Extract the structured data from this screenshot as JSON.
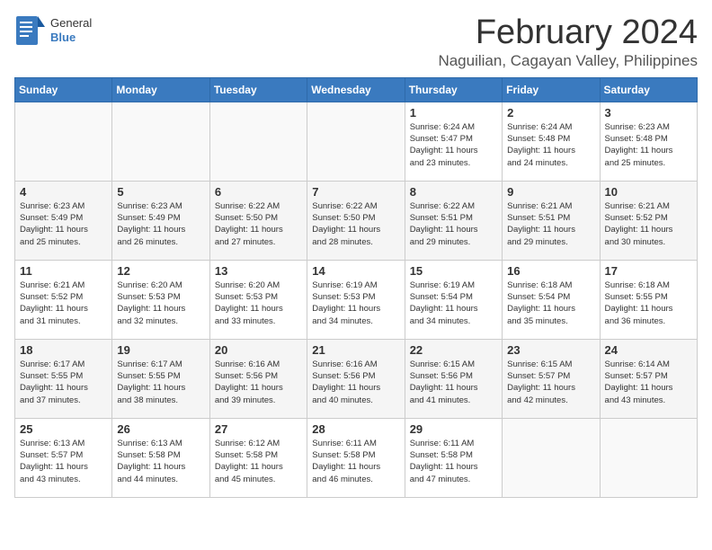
{
  "logo": {
    "text1": "General",
    "text2": "Blue"
  },
  "title": "February 2024",
  "location": "Naguilian, Cagayan Valley, Philippines",
  "days_of_week": [
    "Sunday",
    "Monday",
    "Tuesday",
    "Wednesday",
    "Thursday",
    "Friday",
    "Saturday"
  ],
  "weeks": [
    [
      {
        "day": "",
        "info": ""
      },
      {
        "day": "",
        "info": ""
      },
      {
        "day": "",
        "info": ""
      },
      {
        "day": "",
        "info": ""
      },
      {
        "day": "1",
        "info": "Sunrise: 6:24 AM\nSunset: 5:47 PM\nDaylight: 11 hours\nand 23 minutes."
      },
      {
        "day": "2",
        "info": "Sunrise: 6:24 AM\nSunset: 5:48 PM\nDaylight: 11 hours\nand 24 minutes."
      },
      {
        "day": "3",
        "info": "Sunrise: 6:23 AM\nSunset: 5:48 PM\nDaylight: 11 hours\nand 25 minutes."
      }
    ],
    [
      {
        "day": "4",
        "info": "Sunrise: 6:23 AM\nSunset: 5:49 PM\nDaylight: 11 hours\nand 25 minutes."
      },
      {
        "day": "5",
        "info": "Sunrise: 6:23 AM\nSunset: 5:49 PM\nDaylight: 11 hours\nand 26 minutes."
      },
      {
        "day": "6",
        "info": "Sunrise: 6:22 AM\nSunset: 5:50 PM\nDaylight: 11 hours\nand 27 minutes."
      },
      {
        "day": "7",
        "info": "Sunrise: 6:22 AM\nSunset: 5:50 PM\nDaylight: 11 hours\nand 28 minutes."
      },
      {
        "day": "8",
        "info": "Sunrise: 6:22 AM\nSunset: 5:51 PM\nDaylight: 11 hours\nand 29 minutes."
      },
      {
        "day": "9",
        "info": "Sunrise: 6:21 AM\nSunset: 5:51 PM\nDaylight: 11 hours\nand 29 minutes."
      },
      {
        "day": "10",
        "info": "Sunrise: 6:21 AM\nSunset: 5:52 PM\nDaylight: 11 hours\nand 30 minutes."
      }
    ],
    [
      {
        "day": "11",
        "info": "Sunrise: 6:21 AM\nSunset: 5:52 PM\nDaylight: 11 hours\nand 31 minutes."
      },
      {
        "day": "12",
        "info": "Sunrise: 6:20 AM\nSunset: 5:53 PM\nDaylight: 11 hours\nand 32 minutes."
      },
      {
        "day": "13",
        "info": "Sunrise: 6:20 AM\nSunset: 5:53 PM\nDaylight: 11 hours\nand 33 minutes."
      },
      {
        "day": "14",
        "info": "Sunrise: 6:19 AM\nSunset: 5:53 PM\nDaylight: 11 hours\nand 34 minutes."
      },
      {
        "day": "15",
        "info": "Sunrise: 6:19 AM\nSunset: 5:54 PM\nDaylight: 11 hours\nand 34 minutes."
      },
      {
        "day": "16",
        "info": "Sunrise: 6:18 AM\nSunset: 5:54 PM\nDaylight: 11 hours\nand 35 minutes."
      },
      {
        "day": "17",
        "info": "Sunrise: 6:18 AM\nSunset: 5:55 PM\nDaylight: 11 hours\nand 36 minutes."
      }
    ],
    [
      {
        "day": "18",
        "info": "Sunrise: 6:17 AM\nSunset: 5:55 PM\nDaylight: 11 hours\nand 37 minutes."
      },
      {
        "day": "19",
        "info": "Sunrise: 6:17 AM\nSunset: 5:55 PM\nDaylight: 11 hours\nand 38 minutes."
      },
      {
        "day": "20",
        "info": "Sunrise: 6:16 AM\nSunset: 5:56 PM\nDaylight: 11 hours\nand 39 minutes."
      },
      {
        "day": "21",
        "info": "Sunrise: 6:16 AM\nSunset: 5:56 PM\nDaylight: 11 hours\nand 40 minutes."
      },
      {
        "day": "22",
        "info": "Sunrise: 6:15 AM\nSunset: 5:56 PM\nDaylight: 11 hours\nand 41 minutes."
      },
      {
        "day": "23",
        "info": "Sunrise: 6:15 AM\nSunset: 5:57 PM\nDaylight: 11 hours\nand 42 minutes."
      },
      {
        "day": "24",
        "info": "Sunrise: 6:14 AM\nSunset: 5:57 PM\nDaylight: 11 hours\nand 43 minutes."
      }
    ],
    [
      {
        "day": "25",
        "info": "Sunrise: 6:13 AM\nSunset: 5:57 PM\nDaylight: 11 hours\nand 43 minutes."
      },
      {
        "day": "26",
        "info": "Sunrise: 6:13 AM\nSunset: 5:58 PM\nDaylight: 11 hours\nand 44 minutes."
      },
      {
        "day": "27",
        "info": "Sunrise: 6:12 AM\nSunset: 5:58 PM\nDaylight: 11 hours\nand 45 minutes."
      },
      {
        "day": "28",
        "info": "Sunrise: 6:11 AM\nSunset: 5:58 PM\nDaylight: 11 hours\nand 46 minutes."
      },
      {
        "day": "29",
        "info": "Sunrise: 6:11 AM\nSunset: 5:58 PM\nDaylight: 11 hours\nand 47 minutes."
      },
      {
        "day": "",
        "info": ""
      },
      {
        "day": "",
        "info": ""
      }
    ]
  ]
}
